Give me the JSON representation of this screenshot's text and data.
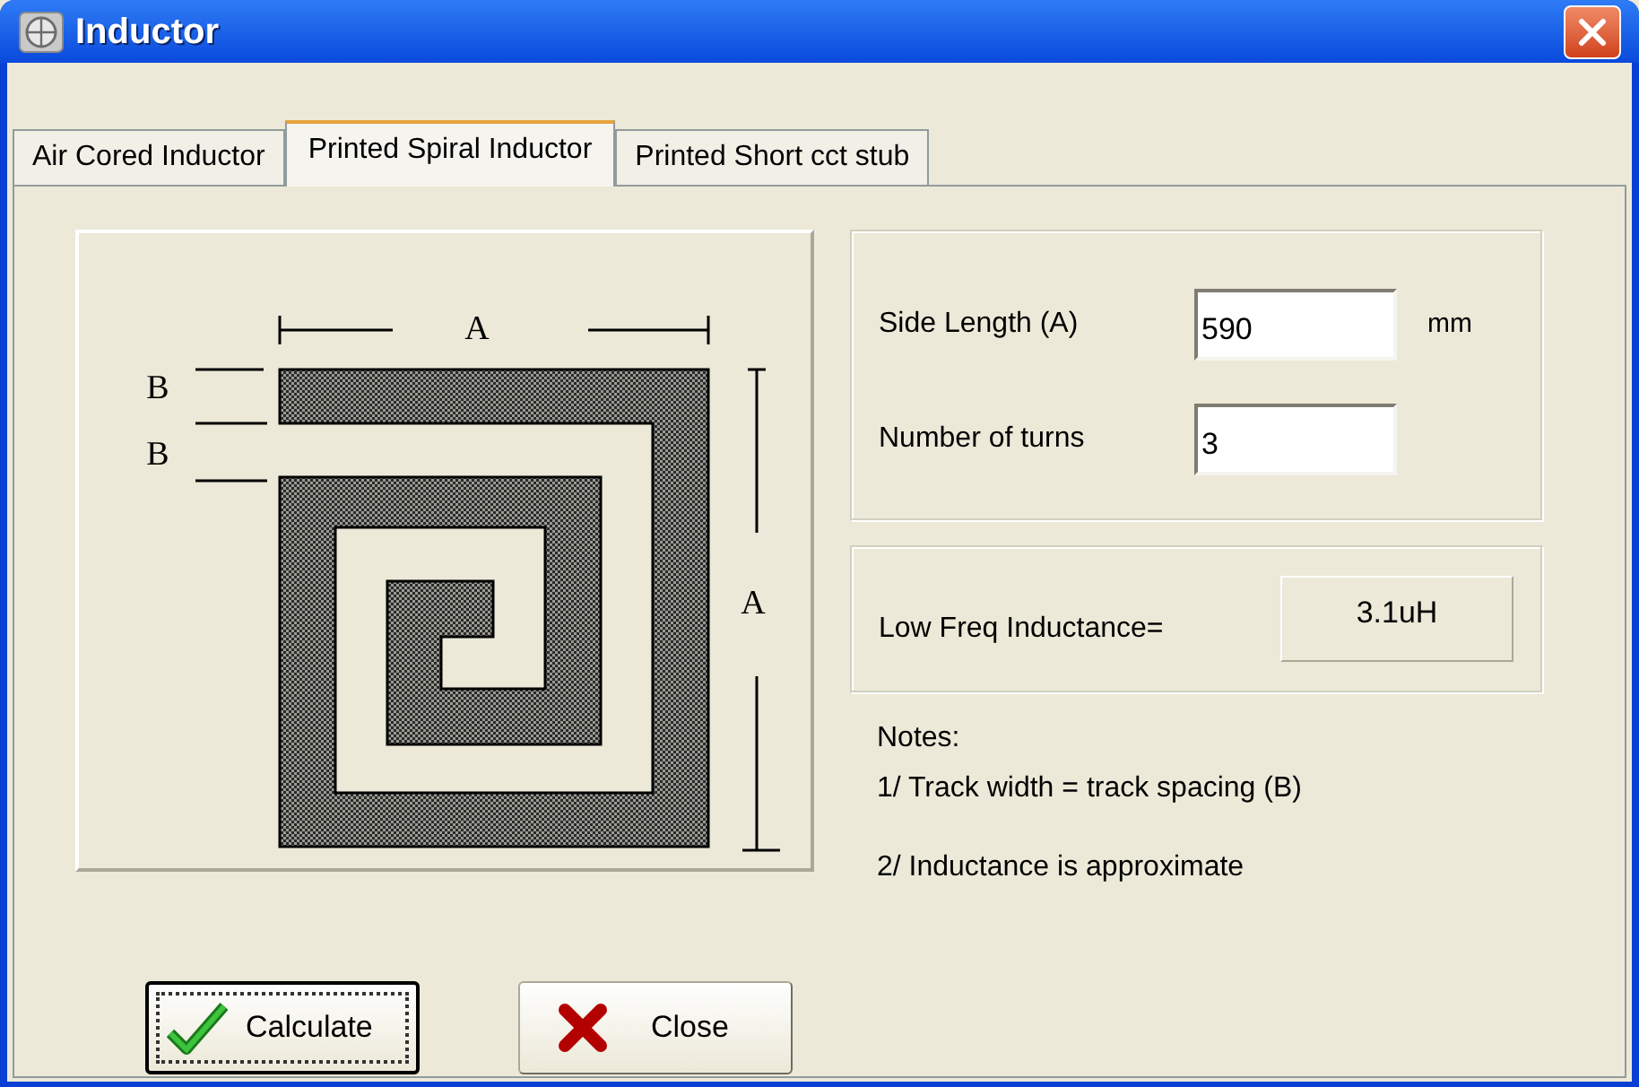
{
  "window": {
    "title": "Inductor"
  },
  "tabs": [
    {
      "label": "Air Cored Inductor",
      "selected": false
    },
    {
      "label": "Printed Spiral Inductor",
      "selected": true
    },
    {
      "label": "Printed Short cct stub",
      "selected": false
    }
  ],
  "diagram": {
    "dimension_labels": [
      "A",
      "B",
      "B",
      "A"
    ]
  },
  "inputs": [
    {
      "label": "Side Length (A)",
      "value": "590",
      "unit": "mm"
    },
    {
      "label": "Number of turns",
      "value": "3"
    }
  ],
  "result": {
    "label": "Low Freq Inductance=",
    "value": "3.1uH"
  },
  "notes": {
    "heading": "Notes:",
    "items": [
      "1/ Track width = track spacing (B)",
      "2/ Inductance is approximate"
    ]
  },
  "buttons": [
    {
      "label": "Calculate",
      "kind": "ok",
      "focused": true
    },
    {
      "label": "Close",
      "kind": "close",
      "focused": false
    }
  ]
}
